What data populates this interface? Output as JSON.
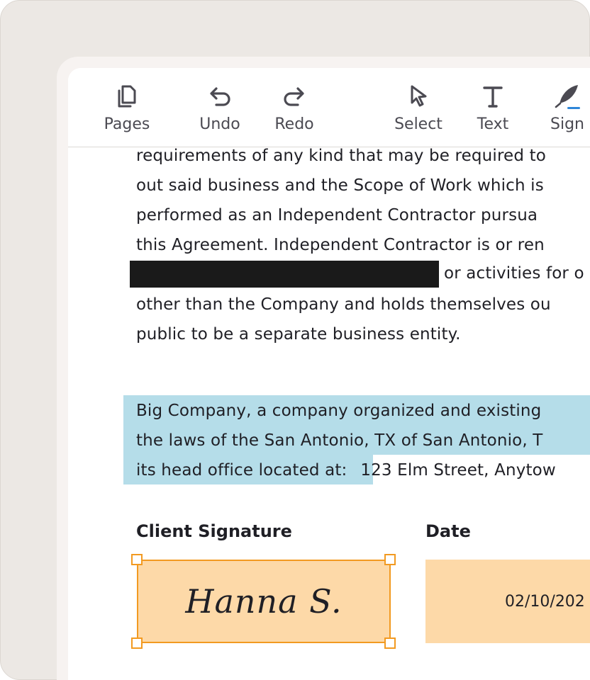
{
  "toolbar": {
    "tools": [
      {
        "label": "Pages",
        "icon": "pages-icon"
      },
      {
        "label": "Undo",
        "icon": "undo-icon"
      },
      {
        "label": "Redo",
        "icon": "redo-icon"
      },
      {
        "label": "Select",
        "icon": "cursor-icon"
      },
      {
        "label": "Text",
        "icon": "text-icon"
      },
      {
        "label": "Sign",
        "icon": "quill-icon"
      }
    ]
  },
  "document": {
    "paragraph1": [
      "requirements of any kind that may be required to",
      "out said business and the Scope of Work which is",
      "performed as an Independent Contractor pursua",
      "this Agreement. Independent Contractor is or ren",
      "or activities for o",
      "other than the Company and holds themselves ou",
      "public to be a separate business entity."
    ],
    "paragraph2": [
      "Big Company, a company organized and existing",
      "the laws of the San Antonio, TX of San Antonio, T",
      "its head office located at:",
      "123 Elm Street, Anytow"
    ]
  },
  "fields": {
    "client_signature_label": "Client Signature",
    "client_signature_value": "Hanna S.",
    "date_label": "Date",
    "date_value": "02/10/202"
  },
  "colors": {
    "highlight": "#b5dde9",
    "field_fill": "#fdd9a8",
    "selection": "#f29a21",
    "sign_accent": "#2f86d8",
    "redaction": "#1a1a1a"
  }
}
